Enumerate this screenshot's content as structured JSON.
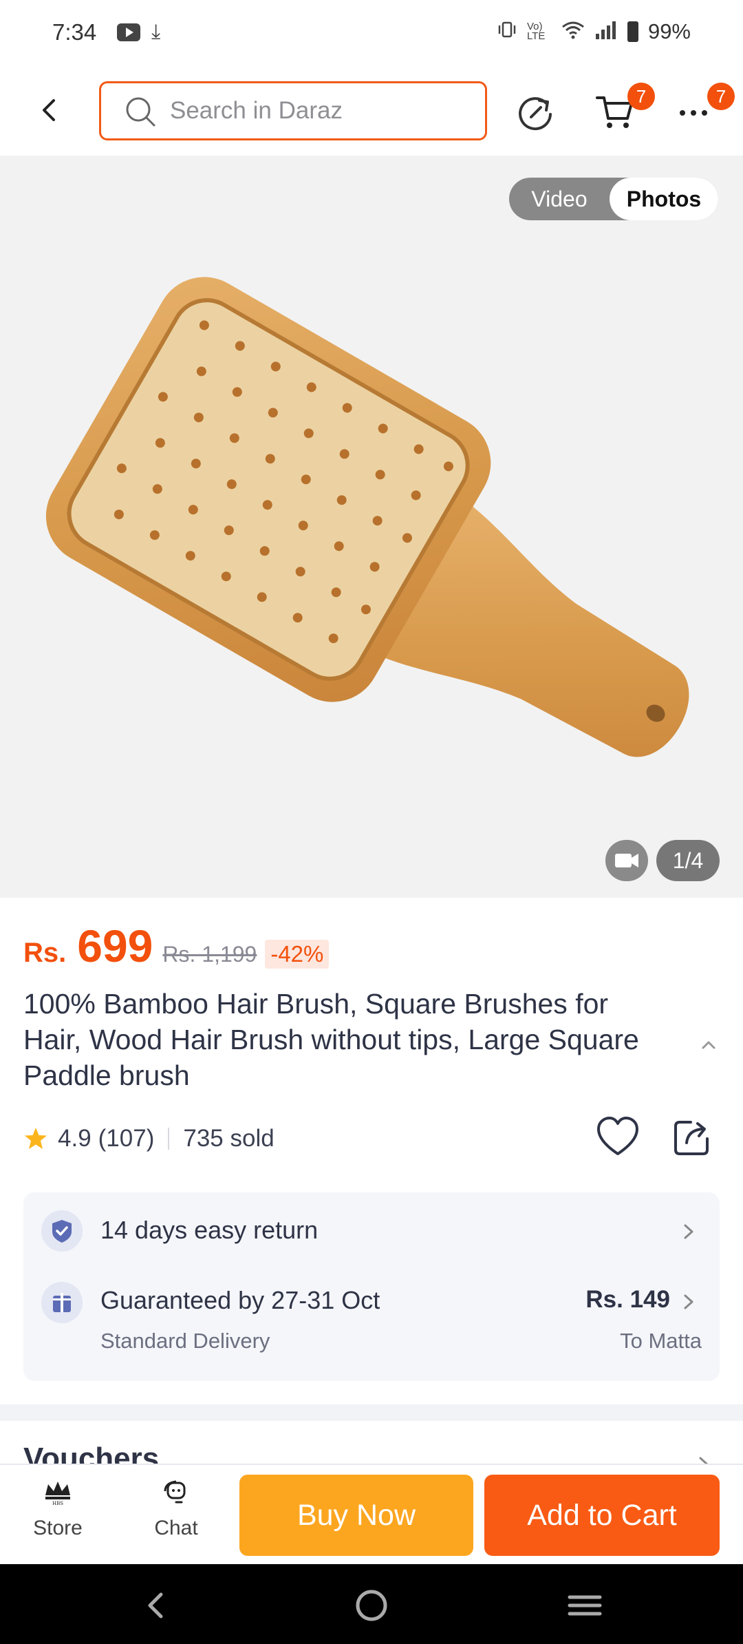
{
  "status_bar": {
    "time": "7:34",
    "download_glyph": "⤓",
    "network": "Vo) LTE",
    "battery": "99%"
  },
  "header": {
    "search_placeholder": "Search in Daraz",
    "cart_badge": "7",
    "more_badge": "7",
    "icons": [
      "back-arrow-icon",
      "search-icon",
      "refresh-icon",
      "cart-icon",
      "more-icon"
    ]
  },
  "gallery": {
    "toggle_video": "Video",
    "toggle_photos": "Photos",
    "page_counter": "1/4"
  },
  "product": {
    "currency": "Rs.",
    "price": "699",
    "original_price": "Rs. 1,199",
    "discount": "-42%",
    "title": "100% Bamboo Hair Brush, Square Brushes for Hair, Wood Hair Brush without tips, Large Square Paddle brush",
    "rating": "4.9",
    "review_count": "(107)",
    "sold": "735 sold"
  },
  "services": {
    "return_label": "14 days easy return",
    "delivery_label": "Guaranteed by 27-31 Oct",
    "delivery_type": "Standard Delivery",
    "delivery_price": "Rs. 149",
    "delivery_destination": "To Matta"
  },
  "vouchers": {
    "title": "Vouchers"
  },
  "bottom_bar": {
    "store_label": "Store",
    "chat_label": "Chat",
    "buy_now": "Buy Now",
    "add_to_cart": "Add to Cart"
  },
  "colors": {
    "accent": "#f2500c",
    "buy_now": "#fca620",
    "add_to_cart": "#f95b14"
  }
}
